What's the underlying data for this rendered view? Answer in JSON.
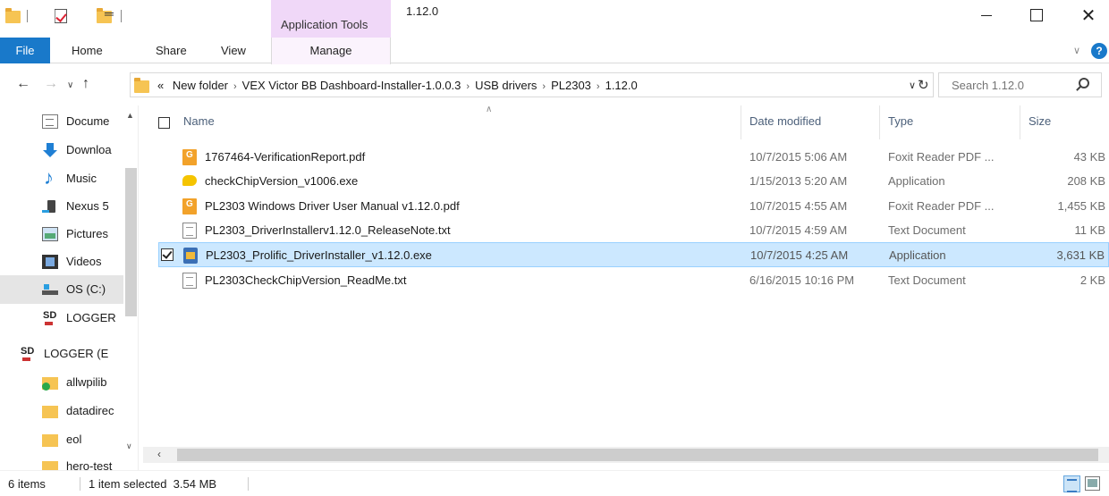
{
  "window": {
    "title": "1.12.0",
    "contextual_tab_group": "Application Tools",
    "close_glyph": "✕"
  },
  "ribbon": {
    "tabs": [
      {
        "label": "File"
      },
      {
        "label": "Home"
      },
      {
        "label": "Share"
      },
      {
        "label": "View"
      },
      {
        "label": "Manage"
      }
    ],
    "help_glyph": "?"
  },
  "address": {
    "overflow": "«",
    "crumbs": [
      "New folder",
      "VEX Victor BB Dashboard-Installer-1.0.0.3",
      "USB drivers",
      "PL2303",
      "1.12.0"
    ]
  },
  "search": {
    "placeholder": "Search 1.12.0"
  },
  "nav_pane": {
    "items": [
      {
        "label": "Docume",
        "icon": "documents-icon"
      },
      {
        "label": "Downloa",
        "icon": "downloads-icon"
      },
      {
        "label": "Music",
        "icon": "music-icon"
      },
      {
        "label": "Nexus 5",
        "icon": "phone-icon"
      },
      {
        "label": "Pictures",
        "icon": "pictures-icon"
      },
      {
        "label": "Videos",
        "icon": "videos-icon"
      },
      {
        "label": "OS (C:)",
        "icon": "drive-icon",
        "selected": true
      },
      {
        "label": "LOGGER",
        "icon": "sd-card-icon"
      },
      {
        "label": "LOGGER (E",
        "icon": "sd-card-icon"
      },
      {
        "label": "allwpilib",
        "icon": "sync-folder-icon"
      },
      {
        "label": "datadirec",
        "icon": "folder-icon"
      },
      {
        "label": "eol",
        "icon": "folder-icon"
      },
      {
        "label": "hero-test",
        "icon": "folder-icon"
      }
    ]
  },
  "columns": {
    "name": "Name",
    "date": "Date modified",
    "type": "Type",
    "size": "Size"
  },
  "files": [
    {
      "name": "1767464-VerificationReport.pdf",
      "date": "10/7/2015 5:06 AM",
      "type": "Foxit Reader PDF ...",
      "size": "43 KB",
      "icon": "pdf-icon",
      "selected": false
    },
    {
      "name": "checkChipVersion_v1006.exe",
      "date": "1/15/2013 5:20 AM",
      "type": "Application",
      "size": "208 KB",
      "icon": "application-icon",
      "selected": false
    },
    {
      "name": "PL2303 Windows Driver User Manual v1.12.0.pdf",
      "date": "10/7/2015 4:55 AM",
      "type": "Foxit Reader PDF ...",
      "size": "1,455 KB",
      "icon": "pdf-icon",
      "selected": false
    },
    {
      "name": "PL2303_DriverInstallerv1.12.0_ReleaseNote.txt",
      "date": "10/7/2015 4:59 AM",
      "type": "Text Document",
      "size": "11 KB",
      "icon": "text-file-icon",
      "selected": false
    },
    {
      "name": "PL2303_Prolific_DriverInstaller_v1.12.0.exe",
      "date": "10/7/2015 4:25 AM",
      "type": "Application",
      "size": "3,631 KB",
      "icon": "installer-icon",
      "selected": true
    },
    {
      "name": "PL2303CheckChipVersion_ReadMe.txt",
      "date": "6/16/2015 10:16 PM",
      "type": "Text Document",
      "size": "2 KB",
      "icon": "text-file-icon",
      "selected": false
    }
  ],
  "status": {
    "item_count": "6 items",
    "selection": "1 item selected  3.54 MB"
  }
}
